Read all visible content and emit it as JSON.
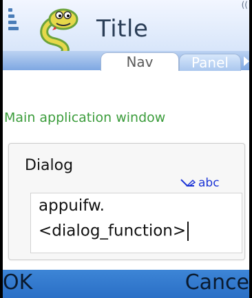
{
  "window": {
    "title": "Title",
    "indicator": "(("
  },
  "tabs": [
    {
      "label": "Nav",
      "active": true
    },
    {
      "label": "Panel",
      "active": false
    }
  ],
  "main": {
    "text": "Main application window"
  },
  "dialog": {
    "title": "Dialog",
    "input_mode": "abc",
    "input_lines": [
      "appuifw.",
      "<dialog_function>"
    ]
  },
  "softkeys": {
    "left": "OK",
    "right": "Cance"
  },
  "colors": {
    "main_text": "#3a9c3a",
    "softkey_bar": "#2f78cf",
    "input_mode": "#1a33d6"
  },
  "icons": [
    "signal-icon",
    "python-logo-icon",
    "antenna-icon",
    "battery-icon",
    "pen-icon",
    "right-arrow-icon"
  ]
}
